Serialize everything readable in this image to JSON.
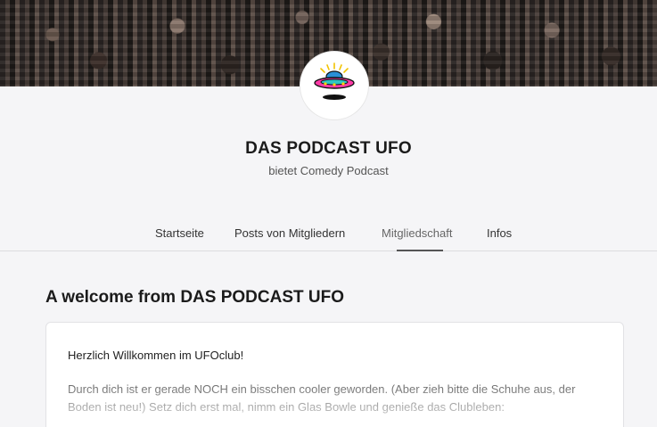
{
  "creator": {
    "name": "DAS PODCAST UFO",
    "tagline": "bietet Comedy Podcast",
    "avatar_icon": "ufo-icon",
    "banner_image": "crowd-audience-photo"
  },
  "tabs": [
    {
      "label": "Startseite",
      "active": false
    },
    {
      "label": "Posts von Mitgliedern",
      "active": false
    },
    {
      "label": "Mitgliedschaft",
      "active": true
    },
    {
      "label": "Infos",
      "active": false
    }
  ],
  "welcome": {
    "title": "A welcome from DAS PODCAST UFO",
    "greeting": "Herzlich Willkommen im UFOclub!",
    "body": "Durch dich ist er gerade NOCH ein bisschen cooler geworden. (Aber zieh bitte die Schuhe aus, der Boden ist neu!) Setz dich erst mal, nimm ein Glas Bowle und genieße das Clubleben:"
  },
  "colors": {
    "page_background": "#f5f5f7",
    "card_background": "#ffffff",
    "active_tab_underline": "#555555"
  }
}
